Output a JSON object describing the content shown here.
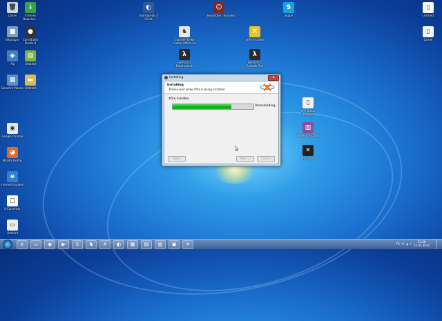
{
  "desktop": {
    "icons": [
      {
        "label": "Camel",
        "glyph": "🗑",
        "bg": "#c9d6e3",
        "icon": "recycle-bin-icon"
      },
      {
        "label": "Internet Downloa...",
        "glyph": "↓",
        "bg": "#3aa14a",
        "icon": "internet-download-manager-icon"
      },
      {
        "label": "Bilgisayar",
        "glyph": "■",
        "bg": "#7e9fbf",
        "icon": "computer-icon"
      },
      {
        "label": "CamStudio Studio 8",
        "glyph": "●",
        "bg": "#333333",
        "icon": "camstudio-icon"
      },
      {
        "label": "Ağ",
        "glyph": "◆",
        "bg": "#3f7fc0",
        "icon": "network-icon"
      },
      {
        "label": "Untitled",
        "glyph": "▤",
        "bg": "#7cb342",
        "icon": "notepad-icon"
      },
      {
        "label": "Denetim Masası",
        "glyph": "▦",
        "bg": "#5e8fc8",
        "icon": "control-panel-icon"
      },
      {
        "label": "Untitled",
        "glyph": "▬",
        "bg": "#e0b94a",
        "icon": "folder-icon"
      },
      {
        "label": "Google Chrome",
        "glyph": "◉",
        "bg": "#e9e9e9",
        "icon": "chrome-icon"
      },
      {
        "label": "Mozilla Firefox",
        "glyph": "◕",
        "bg": "#e66a1e",
        "icon": "firefox-icon"
      },
      {
        "label": "Internet Explorer",
        "glyph": "e",
        "bg": "#2f7fd6",
        "icon": "internet-explorer-icon"
      },
      {
        "label": "X-Converter",
        "glyph": "▢",
        "bg": "#ffffff",
        "icon": "document-icon"
      },
      {
        "label": "Untitled",
        "glyph": "▭",
        "bg": "#efefef",
        "icon": "blank-document-icon"
      },
      {
        "label": "TeamSpeak 3 Client",
        "glyph": "◐",
        "bg": "#2a5a98",
        "icon": "teamspeak-icon"
      },
      {
        "label": "HonorDev...Kraalleri",
        "glyph": "☺",
        "bg": "#7a2a2a",
        "icon": "game-avatar-icon"
      },
      {
        "label": "Skype",
        "glyph": "S",
        "bg": "#1aa0e8",
        "icon": "skype-icon"
      },
      {
        "label": "Counter-Strike Global Offensive",
        "glyph": "♞",
        "bg": "#e8e8e8",
        "icon": "counter-strike-icon"
      },
      {
        "label": "xfire installer",
        "glyph": "X",
        "bg": "#f0c020",
        "icon": "xfire-icon"
      },
      {
        "label": "Half-Life 2 Deathmatch",
        "glyph": "λ",
        "bg": "#2a2a2a",
        "icon": "half-life-icon"
      },
      {
        "label": "Half-Life 2 Episode Two",
        "glyph": "λ",
        "bg": "#2a2a2a",
        "icon": "half-life-episode-icon"
      },
      {
        "label": "Yeni Klasör Belgesi",
        "glyph": "▯",
        "bg": "#f2f2f2",
        "icon": "text-document-icon"
      },
      {
        "label": "WinRAR Archive",
        "glyph": "▥",
        "bg": "#8a4fa0",
        "icon": "winrar-icon"
      },
      {
        "label": "Pro Eraser",
        "glyph": "✕",
        "bg": "#222222",
        "icon": "eraser-app-icon"
      },
      {
        "label": "Untitled",
        "glyph": "▯",
        "bg": "#f7f7f7",
        "icon": "file-icon"
      },
      {
        "label": "Camel",
        "glyph": "▯",
        "bg": "#f7f7f7",
        "icon": "file2-icon"
      }
    ]
  },
  "dialog": {
    "title": "Installing",
    "header_title": "Installing",
    "header_subtitle": "Please wait while Xfire is being installed",
    "section_label": "Xfire Installer",
    "status": "Downloading...",
    "progress_percent": 73,
    "buttons": {
      "back": "Back",
      "next": "Next >",
      "cancel": "Cancel"
    },
    "close_glyph": "x"
  },
  "taskbar": {
    "pinned": [
      "Internet Explorer",
      "Windows Explorer",
      "Google Chrome",
      "Media",
      "Skype",
      "Counter-Strike",
      "Xfire",
      "Steam",
      "Program",
      "Program",
      "Program",
      "Program",
      "Pro Eraser"
    ],
    "tray_lang": "TR",
    "time": "23:36",
    "date": "11.01.2014"
  },
  "colors": {
    "accent_green": "#17b425",
    "desktop_blue": "#1b6fcf"
  }
}
